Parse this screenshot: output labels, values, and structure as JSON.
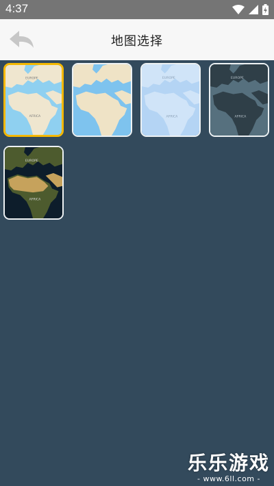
{
  "status_bar": {
    "time": "4:37",
    "icons": [
      "wifi-icon",
      "signal-icon",
      "battery-charging-icon"
    ]
  },
  "header": {
    "title": "地图选择",
    "back_icon": "back-arrow-icon"
  },
  "maps": [
    {
      "id": "light-blue",
      "selected": true,
      "europe_label": "EUROPE",
      "africa_label": "AFRICA",
      "colors": {
        "sea": "#8fd0f0",
        "land": "#efe6cf",
        "text": "#7a7a7a"
      }
    },
    {
      "id": "beige-blue",
      "selected": false,
      "europe_label": "",
      "africa_label": "",
      "colors": {
        "sea": "#7ec3ee",
        "land": "#efe3c6",
        "text": "#7a7a7a"
      }
    },
    {
      "id": "pale-blue",
      "selected": false,
      "europe_label": "EUROPE",
      "africa_label": "AFRICA",
      "colors": {
        "sea": "#b4d4f4",
        "land": "#d0e4f8",
        "text": "#8a9fb5"
      }
    },
    {
      "id": "dark",
      "selected": false,
      "europe_label": "EUROPE",
      "africa_label": "AFRICA",
      "colors": {
        "sea": "#56707e",
        "land": "#2f3f48",
        "text": "#b8c4cc"
      }
    },
    {
      "id": "satellite",
      "selected": false,
      "europe_label": "EUROPE",
      "africa_label": "AFRICA",
      "colors": {
        "sea": "#0d1d2b",
        "land": "#4d5b2e",
        "desert": "#c6a25c",
        "text": "#dcdcdc"
      }
    }
  ],
  "watermark": {
    "brand": "乐乐游戏",
    "url": "- www.6ll.com -"
  },
  "colors": {
    "background": "#334a5c",
    "header_bg": "#f7f7f7",
    "status_bar_bg": "#757575",
    "selected_border": "#f5b800"
  }
}
